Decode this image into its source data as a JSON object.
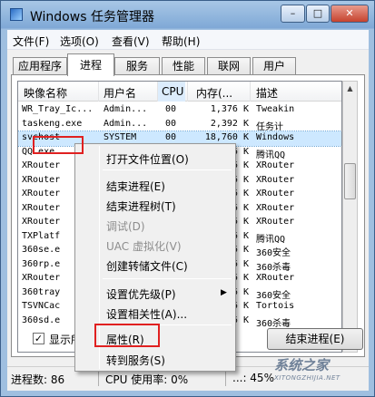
{
  "window": {
    "title": "Windows 任务管理器",
    "min_label": "–",
    "max_label": "□",
    "close_label": "✕"
  },
  "menu": [
    "文件(F)",
    "选项(O)",
    "查看(V)",
    "帮助(H)"
  ],
  "tabs": [
    "应用程序",
    "进程",
    "服务",
    "性能",
    "联网",
    "用户"
  ],
  "active_tab": "进程",
  "columns": [
    "映像名称",
    "用户名",
    "CPU",
    "内存(...",
    "描述"
  ],
  "rows": [
    {
      "name": "WR_Tray_Ic...",
      "user": "Admin...",
      "cpu": "00",
      "mem": "1,376 K",
      "desc": "Tweakin"
    },
    {
      "name": "taskeng.exe",
      "user": "Admin...",
      "cpu": "00",
      "mem": "2,392 K",
      "desc": "任务计"
    },
    {
      "name": "svchost",
      "user": "SYSTEM",
      "cpu": "00",
      "mem": "18,760 K",
      "desc": "Windows"
    },
    {
      "name": "QQ.exe",
      "user": "",
      "cpu": "",
      "mem": "36 K",
      "desc": "腾讯QQ"
    },
    {
      "name": "XRouter",
      "user": "",
      "cpu": "",
      "mem": "36 K",
      "desc": "XRouter"
    },
    {
      "name": "XRouter",
      "user": "",
      "cpu": "",
      "mem": "36 K",
      "desc": "XRouter"
    },
    {
      "name": "XRouter",
      "user": "",
      "cpu": "",
      "mem": "36 K",
      "desc": "XRouter"
    },
    {
      "name": "XRouter",
      "user": "",
      "cpu": "",
      "mem": "36 K",
      "desc": "XRouter"
    },
    {
      "name": "XRouter",
      "user": "",
      "cpu": "",
      "mem": "36 K",
      "desc": "XRouter"
    },
    {
      "name": "TXPlatf",
      "user": "",
      "cpu": "",
      "mem": "36 K",
      "desc": "腾讯QQ"
    },
    {
      "name": "360se.e",
      "user": "",
      "cpu": "",
      "mem": "36 K",
      "desc": "360安全"
    },
    {
      "name": "360rp.e",
      "user": "",
      "cpu": "",
      "mem": "36 K",
      "desc": "360杀毒"
    },
    {
      "name": "XRouter",
      "user": "",
      "cpu": "",
      "mem": "36 K",
      "desc": "XRouter"
    },
    {
      "name": "360tray",
      "user": "",
      "cpu": "",
      "mem": "36 K",
      "desc": "360安全"
    },
    {
      "name": "TSVNCac",
      "user": "",
      "cpu": "",
      "mem": "36 K",
      "desc": "Tortois"
    },
    {
      "name": "360sd.e",
      "user": "",
      "cpu": "",
      "mem": "36 K",
      "desc": "360杀毒"
    }
  ],
  "show_all_label": "显示所",
  "show_all_checked_mark": "✓",
  "end_process_label": "结束进程(E)",
  "status": {
    "processes": "进程数: 86",
    "cpu": "CPU 使用率: 0%",
    "memory": "...: 45%"
  },
  "context_menu": [
    {
      "label": "打开文件位置(O)",
      "enabled": true
    },
    {
      "label": "结束进程(E)",
      "enabled": true
    },
    {
      "label": "结束进程树(T)",
      "enabled": true
    },
    {
      "label": "调试(D)",
      "enabled": false
    },
    {
      "label": "UAC 虚拟化(V)",
      "enabled": false
    },
    {
      "label": "创建转储文件(C)",
      "enabled": true
    },
    {
      "label": "设置优先级(P)",
      "enabled": true,
      "submenu": true
    },
    {
      "label": "设置相关性(A)...",
      "enabled": true
    },
    {
      "label": "属性(R)",
      "enabled": true
    },
    {
      "label": "转到服务(S)",
      "enabled": true
    }
  ],
  "submenu_arrow": "▶",
  "watermark": {
    "text": "系统之家",
    "sub": "XITONGZHIJIA.NET"
  },
  "colors": {
    "highlight": "#e02020",
    "selection": "#cde8ff"
  }
}
